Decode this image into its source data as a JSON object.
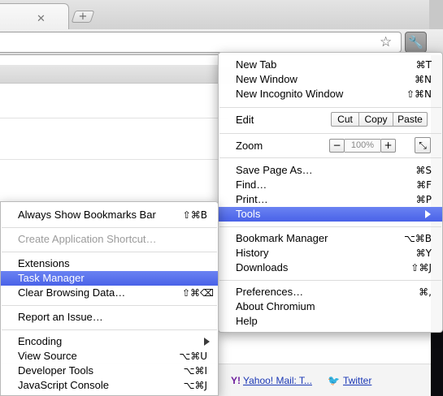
{
  "browser": {
    "tab_close_glyph": "✕",
    "new_tab_glyph": "+",
    "star_glyph": "☆",
    "wrench_glyph": "🔧"
  },
  "bookmarks_bar": {
    "items": [
      {
        "icon": "Y!",
        "icon_color": "#6e1f9e",
        "label": "Yahoo! Mail: T..."
      },
      {
        "icon": "🐦",
        "icon_color": "#2a9fd8",
        "label": "Twitter"
      }
    ]
  },
  "main_menu": {
    "new_tab": {
      "label": "New Tab",
      "shortcut": "⌘T"
    },
    "new_window": {
      "label": "New Window",
      "shortcut": "⌘N"
    },
    "new_incognito": {
      "label": "New Incognito Window",
      "shortcut": "⇧⌘N"
    },
    "edit": {
      "label": "Edit",
      "cut": "Cut",
      "copy": "Copy",
      "paste": "Paste"
    },
    "zoom": {
      "label": "Zoom",
      "minus": "−",
      "value": "100%",
      "plus": "+",
      "fullscreen_glyph": "⤡"
    },
    "save_page": {
      "label": "Save Page As…",
      "shortcut": "⌘S"
    },
    "find": {
      "label": "Find…",
      "shortcut": "⌘F"
    },
    "print": {
      "label": "Print…",
      "shortcut": "⌘P"
    },
    "tools": {
      "label": "Tools"
    },
    "bookmark_manager": {
      "label": "Bookmark Manager",
      "shortcut": "⌥⌘B"
    },
    "history": {
      "label": "History",
      "shortcut": "⌘Y"
    },
    "downloads": {
      "label": "Downloads",
      "shortcut": "⇧⌘J"
    },
    "preferences": {
      "label": "Preferences…",
      "shortcut": "⌘,"
    },
    "about": {
      "label": "About Chromium"
    },
    "help": {
      "label": "Help"
    }
  },
  "tools_menu": {
    "show_bookmarks_bar": {
      "label": "Always Show Bookmarks Bar",
      "shortcut": "⇧⌘B"
    },
    "create_app_shortcut": {
      "label": "Create Application Shortcut…"
    },
    "extensions": {
      "label": "Extensions"
    },
    "task_manager": {
      "label": "Task Manager"
    },
    "clear_browsing_data": {
      "label": "Clear Browsing Data…",
      "shortcut": "⇧⌘⌫"
    },
    "report_issue": {
      "label": "Report an Issue…"
    },
    "encoding": {
      "label": "Encoding"
    },
    "view_source": {
      "label": "View Source",
      "shortcut": "⌥⌘U"
    },
    "developer_tools": {
      "label": "Developer Tools",
      "shortcut": "⌥⌘I"
    },
    "javascript_console": {
      "label": "JavaScript Console",
      "shortcut": "⌥⌘J"
    }
  },
  "colors": {
    "highlight": "#5570ec",
    "disabled_text": "#9b9b9b"
  }
}
